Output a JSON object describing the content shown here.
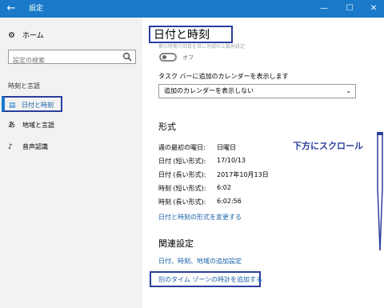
{
  "window": {
    "title": "設定",
    "back_glyph": "←",
    "minimize_glyph": "—",
    "maximize_glyph": "☐",
    "close_glyph": "✕"
  },
  "sidebar": {
    "home_label": "ホーム",
    "search_placeholder": "設定の検索",
    "section_label": "時刻と言語",
    "items": [
      {
        "label": "日付と時刻",
        "icon": "calendar-clock-icon",
        "active": true
      },
      {
        "label": "地域と言語",
        "icon": "language-icon",
        "active": false
      },
      {
        "label": "音声認識",
        "icon": "microphone-icon",
        "active": false
      }
    ]
  },
  "main": {
    "page_title": "日付と時刻",
    "faded_text": "集の時期で回目を目に地域の上載地設定",
    "toggle_state_label": "オフ",
    "calendar_label": "タスク バーに追加のカレンダーを表示します",
    "calendar_dropdown_value": "追加のカレンダーを表示しない",
    "format_heading": "形式",
    "format_rows": [
      {
        "key": "週の最初の曜日:",
        "value": "日曜日"
      },
      {
        "key": "日付 (短い形式):",
        "value": "17/10/13"
      },
      {
        "key": "日付 (長い形式):",
        "value": "2017年10月13日"
      },
      {
        "key": "時刻 (短い形式):",
        "value": "6:02"
      },
      {
        "key": "時刻 (長い形式):",
        "value": "6:02:56"
      }
    ],
    "change_format_link": "日付と時刻の形式を変更する",
    "related_heading": "関連設定",
    "related_links": [
      "日付、時刻、地域の追加設定",
      "別のタイム ゾーンの時計を追加する"
    ]
  },
  "annotation": {
    "text": "下方にスクロール"
  },
  "colors": {
    "titlebar": "#1a7ac9",
    "link": "#1a5fa8",
    "annotation_box": "#2c3e9e",
    "sidebar_bg": "#f2f2f2"
  }
}
